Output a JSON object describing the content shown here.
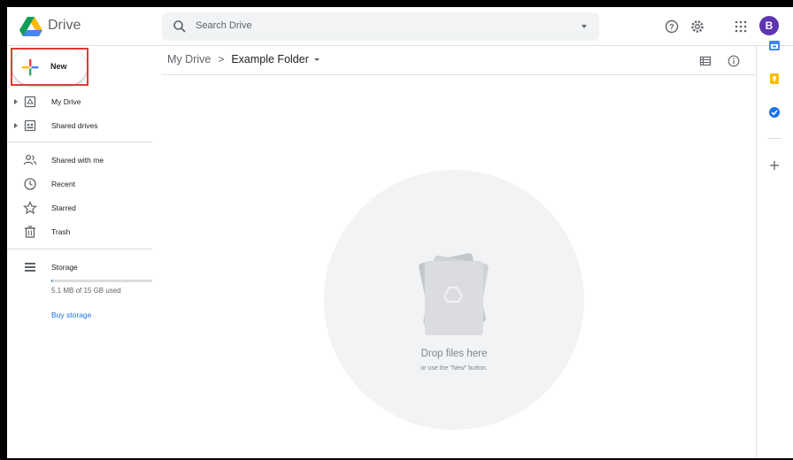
{
  "header": {
    "brand": "Drive",
    "search_placeholder": "Search Drive",
    "icons": [
      "help-icon",
      "settings-icon",
      "apps-grid-icon"
    ],
    "avatar_initial": "B"
  },
  "new_button": {
    "label": "New"
  },
  "sidebar": {
    "items": [
      {
        "label": "My Drive",
        "icon": "my-drive-icon",
        "expandable": true
      },
      {
        "label": "Shared drives",
        "icon": "shared-drives-icon",
        "expandable": true
      },
      {
        "label": "Shared with me",
        "icon": "people-icon"
      },
      {
        "label": "Recent",
        "icon": "clock-icon"
      },
      {
        "label": "Starred",
        "icon": "star-icon"
      },
      {
        "label": "Trash",
        "icon": "trash-icon"
      },
      {
        "label": "Storage",
        "icon": "storage-icon"
      }
    ],
    "storage": {
      "used_text": "5.1 MB of 15 GB used",
      "used_fraction": 0.0003,
      "buy_label": "Buy storage"
    }
  },
  "main": {
    "breadcrumb": {
      "root": "My Drive",
      "separator": ">",
      "current": "Example Folder"
    },
    "view_icons": [
      "list-view-icon",
      "info-icon"
    ],
    "empty_state": {
      "title": "Drop files here",
      "subtitle": "or use the \"New\" button."
    }
  },
  "side_panel": {
    "icons": [
      "calendar-icon",
      "keep-icon",
      "tasks-icon",
      "add-icon"
    ]
  },
  "colors": {
    "accent": "#1a73e8",
    "highlight": "#e53935",
    "avatar": "#5e35b1"
  }
}
